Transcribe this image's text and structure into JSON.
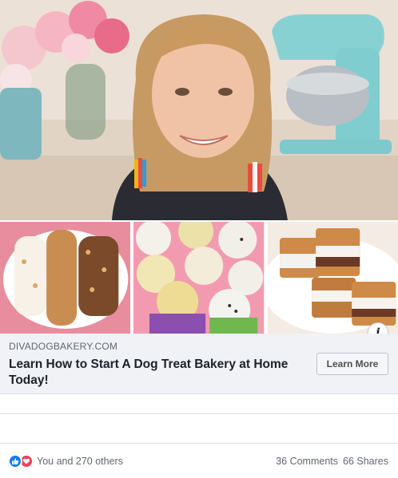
{
  "ad": {
    "domain": "DIVADOGBAKERY.COM",
    "headline": "Learn How to Start A Dog Treat Bakery at Home Today!",
    "cta_label": "Learn More"
  },
  "images": {
    "hero": "woman-in-kitchen-photo",
    "thumbnails": [
      "bone-shaped-dog-treats-photo",
      "frosted-pupcakes-photo",
      "sandwich-dog-treats-photo"
    ]
  },
  "info_icon_glyph": "i",
  "engagement": {
    "reaction_icons": [
      "like-icon",
      "love-icon"
    ],
    "reactions_text": "You and 270 others",
    "comments_text": "36 Comments",
    "shares_text": "66 Shares"
  },
  "colors": {
    "like": "#1877f2",
    "love": "#f33e58",
    "link_bar_bg": "#f0f2f5"
  }
}
